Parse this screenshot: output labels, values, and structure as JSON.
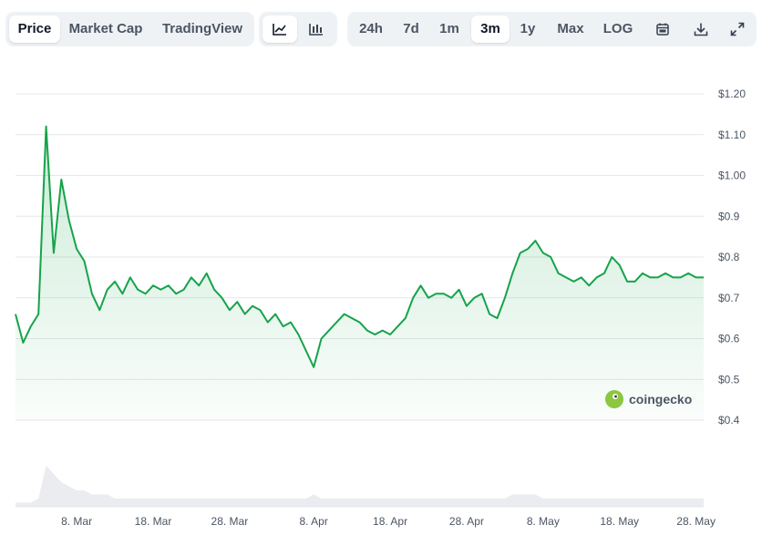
{
  "toolbar": {
    "view_tabs": [
      {
        "label": "Price",
        "active": true
      },
      {
        "label": "Market Cap",
        "active": false
      },
      {
        "label": "TradingView",
        "active": false
      }
    ],
    "chart_styles": [
      {
        "icon": "line-chart-icon",
        "active": true
      },
      {
        "icon": "candlestick-chart-icon",
        "active": false
      }
    ],
    "ranges": [
      {
        "label": "24h",
        "active": false
      },
      {
        "label": "7d",
        "active": false
      },
      {
        "label": "1m",
        "active": false
      },
      {
        "label": "3m",
        "active": true
      },
      {
        "label": "1y",
        "active": false
      },
      {
        "label": "Max",
        "active": false
      },
      {
        "label": "LOG",
        "active": false
      }
    ],
    "tools": [
      {
        "icon": "calendar-icon"
      },
      {
        "icon": "download-icon"
      },
      {
        "icon": "expand-icon"
      }
    ]
  },
  "watermark": "coingecko",
  "colors": {
    "line": "#16a34a",
    "fill_top": "#16a34a",
    "grid": "#e5e7eb",
    "volume": "#eaecef"
  },
  "chart_data": {
    "type": "area",
    "x_start": "2024-02-29",
    "x_end": "2024-05-29",
    "xticks": [
      "8. Mar",
      "18. Mar",
      "28. Mar",
      "8. Apr",
      "18. Apr",
      "28. Apr",
      "8. May",
      "18. May",
      "28. May"
    ],
    "xtick_dates": [
      "2024-03-08",
      "2024-03-18",
      "2024-03-28",
      "2024-04-08",
      "2024-04-18",
      "2024-04-28",
      "2024-05-08",
      "2024-05-18",
      "2024-05-28"
    ],
    "yticks": [
      "$1.20",
      "$1.10",
      "$1.00",
      "$0.9",
      "$0.8",
      "$0.7",
      "$0.6",
      "$0.5",
      "$0.4"
    ],
    "ytick_values": [
      1.2,
      1.1,
      1.0,
      0.9,
      0.8,
      0.7,
      0.6,
      0.5,
      0.4
    ],
    "ylim": [
      0.4,
      1.2
    ],
    "grid": true,
    "series": [
      {
        "x": [
          "2024-02-29",
          "2024-03-01",
          "2024-03-02",
          "2024-03-03",
          "2024-03-04",
          "2024-03-05",
          "2024-03-06",
          "2024-03-07",
          "2024-03-08",
          "2024-03-09",
          "2024-03-10",
          "2024-03-11",
          "2024-03-12",
          "2024-03-13",
          "2024-03-14",
          "2024-03-15",
          "2024-03-16",
          "2024-03-17",
          "2024-03-18",
          "2024-03-19",
          "2024-03-20",
          "2024-03-21",
          "2024-03-22",
          "2024-03-23",
          "2024-03-24",
          "2024-03-25",
          "2024-03-26",
          "2024-03-27",
          "2024-03-28",
          "2024-03-29",
          "2024-03-30",
          "2024-03-31",
          "2024-04-01",
          "2024-04-02",
          "2024-04-03",
          "2024-04-04",
          "2024-04-05",
          "2024-04-06",
          "2024-04-07",
          "2024-04-08",
          "2024-04-09",
          "2024-04-10",
          "2024-04-11",
          "2024-04-12",
          "2024-04-13",
          "2024-04-14",
          "2024-04-15",
          "2024-04-16",
          "2024-04-17",
          "2024-04-18",
          "2024-04-19",
          "2024-04-20",
          "2024-04-21",
          "2024-04-22",
          "2024-04-23",
          "2024-04-24",
          "2024-04-25",
          "2024-04-26",
          "2024-04-27",
          "2024-04-28",
          "2024-04-29",
          "2024-04-30",
          "2024-05-01",
          "2024-05-02",
          "2024-05-03",
          "2024-05-04",
          "2024-05-05",
          "2024-05-06",
          "2024-05-07",
          "2024-05-08",
          "2024-05-09",
          "2024-05-10",
          "2024-05-11",
          "2024-05-12",
          "2024-05-13",
          "2024-05-14",
          "2024-05-15",
          "2024-05-16",
          "2024-05-17",
          "2024-05-18",
          "2024-05-19",
          "2024-05-20",
          "2024-05-21",
          "2024-05-22",
          "2024-05-23",
          "2024-05-24",
          "2024-05-25",
          "2024-05-26",
          "2024-05-27",
          "2024-05-28",
          "2024-05-29"
        ],
        "values": [
          0.66,
          0.59,
          0.63,
          0.66,
          1.12,
          0.81,
          0.99,
          0.89,
          0.82,
          0.79,
          0.71,
          0.67,
          0.72,
          0.74,
          0.71,
          0.75,
          0.72,
          0.71,
          0.73,
          0.72,
          0.73,
          0.71,
          0.72,
          0.75,
          0.73,
          0.76,
          0.72,
          0.7,
          0.67,
          0.69,
          0.66,
          0.68,
          0.67,
          0.64,
          0.66,
          0.63,
          0.64,
          0.61,
          0.57,
          0.53,
          0.6,
          0.62,
          0.64,
          0.66,
          0.65,
          0.64,
          0.62,
          0.61,
          0.62,
          0.61,
          0.63,
          0.65,
          0.7,
          0.73,
          0.7,
          0.71,
          0.71,
          0.7,
          0.72,
          0.68,
          0.7,
          0.71,
          0.66,
          0.65,
          0.7,
          0.76,
          0.81,
          0.82,
          0.84,
          0.81,
          0.8,
          0.76,
          0.75,
          0.74,
          0.75,
          0.73,
          0.75,
          0.76,
          0.8,
          0.78,
          0.74,
          0.74,
          0.76,
          0.75,
          0.75,
          0.76,
          0.75,
          0.75,
          0.76,
          0.75,
          0.75
        ]
      }
    ],
    "volume": [
      1,
      1,
      1,
      2,
      10,
      8,
      6,
      5,
      4,
      4,
      3,
      3,
      3,
      2,
      2,
      2,
      2,
      2,
      2,
      2,
      2,
      2,
      2,
      2,
      2,
      2,
      2,
      2,
      2,
      2,
      2,
      2,
      2,
      2,
      2,
      2,
      2,
      2,
      2,
      3,
      2,
      2,
      2,
      2,
      2,
      2,
      2,
      2,
      2,
      2,
      2,
      2,
      2,
      2,
      2,
      2,
      2,
      2,
      2,
      2,
      2,
      2,
      2,
      2,
      2,
      3,
      3,
      3,
      3,
      2,
      2,
      2,
      2,
      2,
      2,
      2,
      2,
      2,
      2,
      2,
      2,
      2,
      2,
      2,
      2,
      2,
      2,
      2,
      2,
      2,
      2
    ]
  }
}
